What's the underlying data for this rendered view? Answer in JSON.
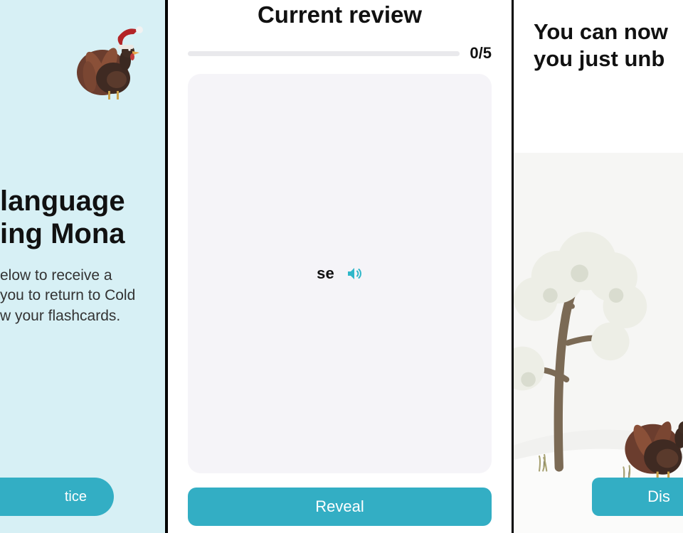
{
  "left": {
    "title_line1": " language",
    "title_line2": "ing Mona",
    "body_line1": "elow to receive a",
    "body_line2": " you to return to Cold",
    "body_line3": "w your flashcards.",
    "cta_label": "tice"
  },
  "mid": {
    "title": "Current review",
    "progress_text": "0/5",
    "word": "se",
    "reveal_label": "Reveal"
  },
  "right": {
    "title_line1": "You can now",
    "title_line2": "you just unb",
    "cta_label": "Dis"
  },
  "icons": {
    "sound": "sound-icon",
    "turkey": "turkey-icon"
  },
  "colors": {
    "accent": "#33aec4"
  }
}
